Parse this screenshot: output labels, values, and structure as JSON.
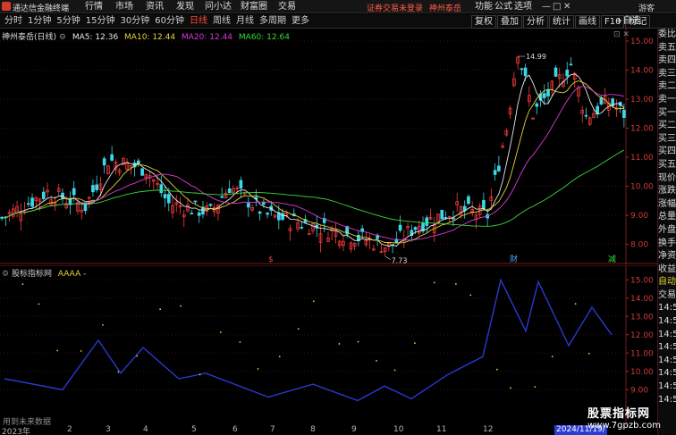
{
  "topbar": {
    "app_title": "通达信金融终端",
    "menu": [
      "行情",
      "市场",
      "资讯",
      "发现",
      "问小达",
      "财富圈",
      "交易"
    ],
    "notice": "证券交易未登录",
    "stock_link": "神州泰岳",
    "right_menu": [
      "功能",
      "公式",
      "选项"
    ],
    "guest": "游客",
    "win_buttons": [
      "—",
      "□",
      "✕"
    ]
  },
  "toolbar": {
    "periods": [
      "分时",
      "1分钟",
      "5分钟",
      "15分钟",
      "30分钟",
      "60分钟",
      "日线",
      "周线",
      "月线",
      "多周期",
      "更多"
    ],
    "active_period": "日线",
    "right_tools": [
      "复权",
      "叠加",
      "分析",
      "统计",
      "画线",
      "F10",
      "标记"
    ],
    "self_select": "+自选"
  },
  "main_chart": {
    "title": "神州泰岳(日线)",
    "ma_labels": [
      {
        "text": "MA5: 12.36",
        "color": "#e8e8e8"
      },
      {
        "text": "MA10: 12.44",
        "color": "#e6d23a"
      },
      {
        "text": "MA20: 12.44",
        "color": "#d83cd8"
      },
      {
        "text": "MA60: 12.64",
        "color": "#3ad83a"
      }
    ],
    "high_label": "14.99",
    "low_label": "7.73",
    "markers": [
      {
        "text": "$",
        "color": "#e04040"
      },
      {
        "text": "财",
        "color": "#4aa0ff"
      },
      {
        "text": "减",
        "color": "#3ad83a"
      }
    ],
    "y_ticks": [
      "15.00",
      "14.00",
      "13.00",
      "12.00",
      "11.00",
      "10.00",
      "9.00",
      "8.00"
    ]
  },
  "indicator_chart": {
    "title": "股标指标网",
    "subtitle": "AAAA",
    "dash": "-",
    "y_ticks": [
      "15.00",
      "14.00",
      "13.00",
      "12.00",
      "11.00",
      "10.00",
      "9.00"
    ],
    "hint": "用到未来数据"
  },
  "side_panel": {
    "items": [
      {
        "text": "委比",
        "c": "w"
      },
      {
        "text": "卖五",
        "c": "w"
      },
      {
        "text": "卖四",
        "c": "w"
      },
      {
        "text": "卖三",
        "c": "w"
      },
      {
        "text": "卖二",
        "c": "w"
      },
      {
        "text": "卖一",
        "c": "w"
      },
      {
        "text": "买一",
        "c": "w"
      },
      {
        "text": "买二",
        "c": "w"
      },
      {
        "text": "买三",
        "c": "w"
      },
      {
        "text": "买四",
        "c": "w"
      },
      {
        "text": "买五",
        "c": "w"
      },
      {
        "text": "现价",
        "c": "w"
      },
      {
        "text": "涨跌",
        "c": "w"
      },
      {
        "text": "涨幅",
        "c": "w"
      },
      {
        "text": "总量",
        "c": "w"
      },
      {
        "text": "外盘",
        "c": "w"
      },
      {
        "text": "换手",
        "c": "w"
      },
      {
        "text": "净资",
        "c": "w"
      },
      {
        "text": "收益",
        "c": "w"
      },
      {
        "text": "自动",
        "c": "y"
      },
      {
        "text": "交易",
        "c": "w"
      },
      {
        "text": "14:56",
        "c": "w"
      },
      {
        "text": "14:56",
        "c": "w"
      },
      {
        "text": "14:56",
        "c": "w"
      },
      {
        "text": "14:56",
        "c": "w"
      },
      {
        "text": "14:56",
        "c": "w"
      },
      {
        "text": "14:56",
        "c": "w"
      },
      {
        "text": "14:56",
        "c": "w"
      },
      {
        "text": "14:56",
        "c": "w"
      }
    ]
  },
  "xaxis": {
    "labels": [
      "2023年",
      "2",
      "3",
      "4",
      "5",
      "6",
      "7",
      "8",
      "9",
      "10",
      "11",
      "12"
    ],
    "date_badge": "2024/11/19/"
  },
  "watermark": {
    "line1": "股票指标网",
    "line2": "www.7gpzb.com"
  },
  "colors": {
    "up": "#ff3c3c",
    "down": "#3ad8e8",
    "ma5": "#e8e8e8",
    "ma10": "#e6d23a",
    "ma20": "#d83cd8",
    "ma60": "#3ad83a",
    "aaaa": "#2a38d0"
  }
}
